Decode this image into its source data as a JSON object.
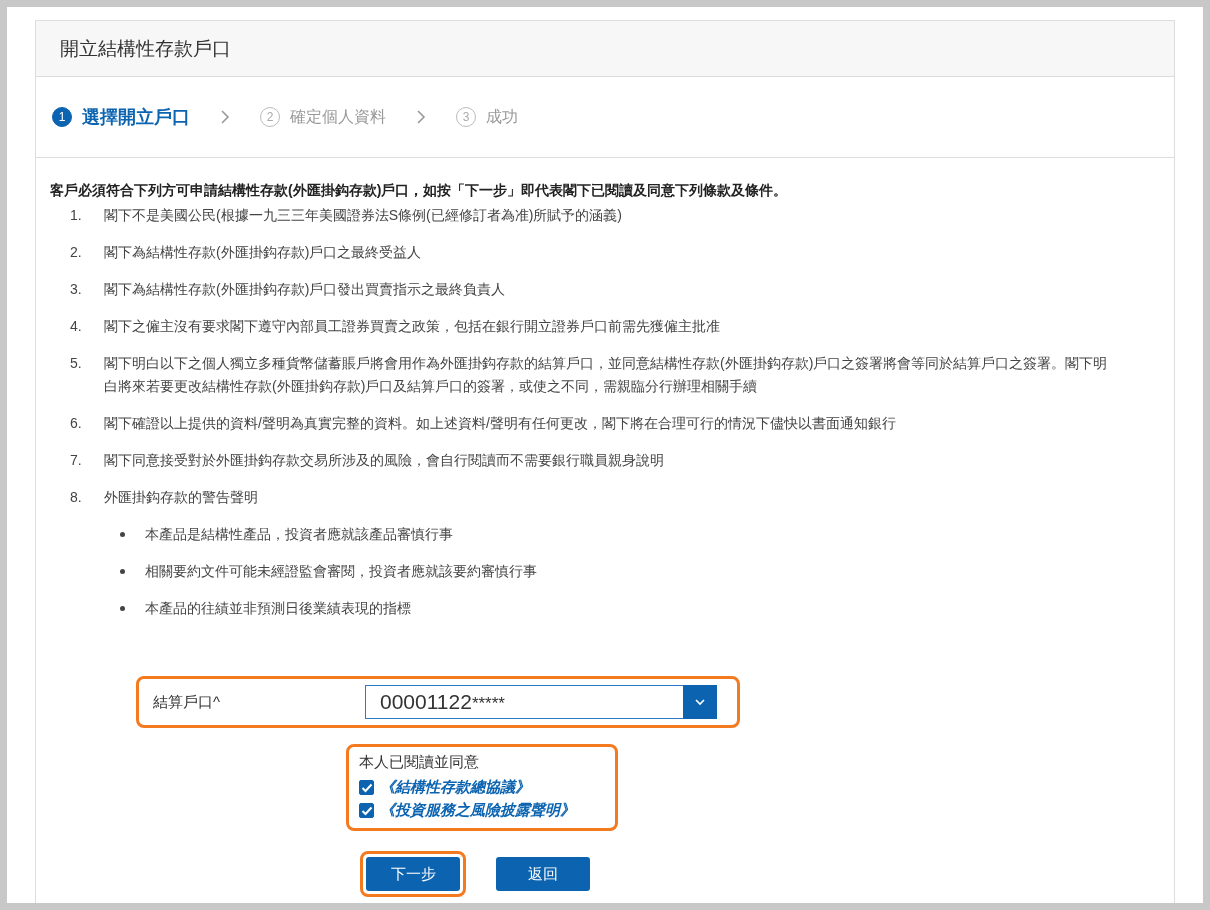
{
  "title": "開立結構性存款戶口",
  "steps": [
    {
      "number": "1",
      "label": "選擇開立戶口",
      "selected": true
    },
    {
      "number": "2",
      "label": "確定個人資料",
      "selected": false
    },
    {
      "number": "3",
      "label": "成功",
      "selected": false
    }
  ],
  "intro": "客戶必須符合下列方可申請結構性存款(外匯掛鈎存款)戶口，如按「下一步」即代表閣下已閱讀及同意下列條款及條件。",
  "terms": [
    {
      "number": "1.",
      "text": "閣下不是美國公民(根據一九三三年美國證券法S條例(已經修訂者為准)所賦予的涵義)"
    },
    {
      "number": "2.",
      "text": "閣下為結構性存款(外匯掛鈎存款)戶口之最終受益人"
    },
    {
      "number": "3.",
      "text": "閣下為結構性存款(外匯掛鈎存款)戶口發出買賣指示之最終負責人"
    },
    {
      "number": "4.",
      "text": "閣下之僱主沒有要求閣下遵守內部員工證券買賣之政策，包括在銀行開立證券戶口前需先獲僱主批准"
    },
    {
      "number": "5.",
      "text": "閣下明白以下之個人獨立多種貨幣儲蓄賬戶將會用作為外匯掛鈎存款的結算戶口，並同意結構性存款(外匯掛鈎存款)戶口之簽署將會等同於結算戶口之簽署。閣下明白將來若要更改結構性存款(外匯掛鈎存款)戶口及結算戶口的簽署，或使之不同，需親臨分行辦理相關手續"
    },
    {
      "number": "6.",
      "text": "閣下確證以上提供的資料/聲明為真實完整的資料。如上述資料/聲明有任何更改，閣下將在合理可行的情況下儘快以書面通知銀行"
    },
    {
      "number": "7.",
      "text": "閣下同意接受對於外匯掛鈎存款交易所涉及的風險，會自行閱讀而不需要銀行職員親身說明"
    },
    {
      "number": "8.",
      "text": "外匯掛鈎存款的警告聲明",
      "bullets": [
        "本產品是結構性產品，投資者應就該產品審慎行事",
        "相關要約文件可能未經證監會審閱，投資者應就該要約審慎行事",
        "本產品的往績並非預測日後業績表現的指標"
      ]
    }
  ],
  "account": {
    "label": "結算戶口^",
    "value": "00001122",
    "mask": "*****",
    "highlighted": true
  },
  "agreement": {
    "label": "本人已閱讀並同意",
    "highlighted": true,
    "items": [
      {
        "text": "《結構性存款總協議》",
        "checked": true
      },
      {
        "text": "《投資服務之風險披露聲明》",
        "checked": true
      }
    ]
  },
  "buttons": [
    {
      "label": "下一步",
      "highlighted": true
    },
    {
      "label": "返回",
      "highlighted": false
    }
  ]
}
